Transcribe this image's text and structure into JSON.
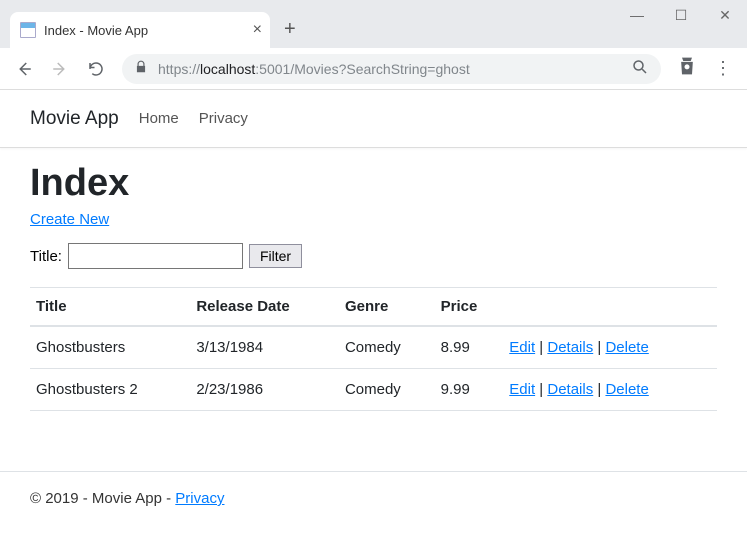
{
  "browser": {
    "tab_title": "Index - Movie App",
    "url": {
      "scheme": "https://",
      "host": "localhost",
      "port": ":5001",
      "path": "/Movies?SearchString=ghost"
    }
  },
  "navbar": {
    "brand": "Movie App",
    "links": [
      "Home",
      "Privacy"
    ]
  },
  "page": {
    "heading": "Index",
    "create_link": "Create New",
    "filter": {
      "label": "Title:",
      "button": "Filter",
      "value": ""
    },
    "table": {
      "headers": [
        "Title",
        "Release Date",
        "Genre",
        "Price",
        ""
      ],
      "rows": [
        {
          "title": "Ghostbusters",
          "release": "3/13/1984",
          "genre": "Comedy",
          "price": "8.99"
        },
        {
          "title": "Ghostbusters 2",
          "release": "2/23/1986",
          "genre": "Comedy",
          "price": "9.99"
        }
      ],
      "actions": {
        "edit": "Edit",
        "details": "Details",
        "delete": "Delete",
        "sep": " | "
      }
    }
  },
  "footer": {
    "text": "© 2019 - Movie App - ",
    "privacy": "Privacy"
  }
}
